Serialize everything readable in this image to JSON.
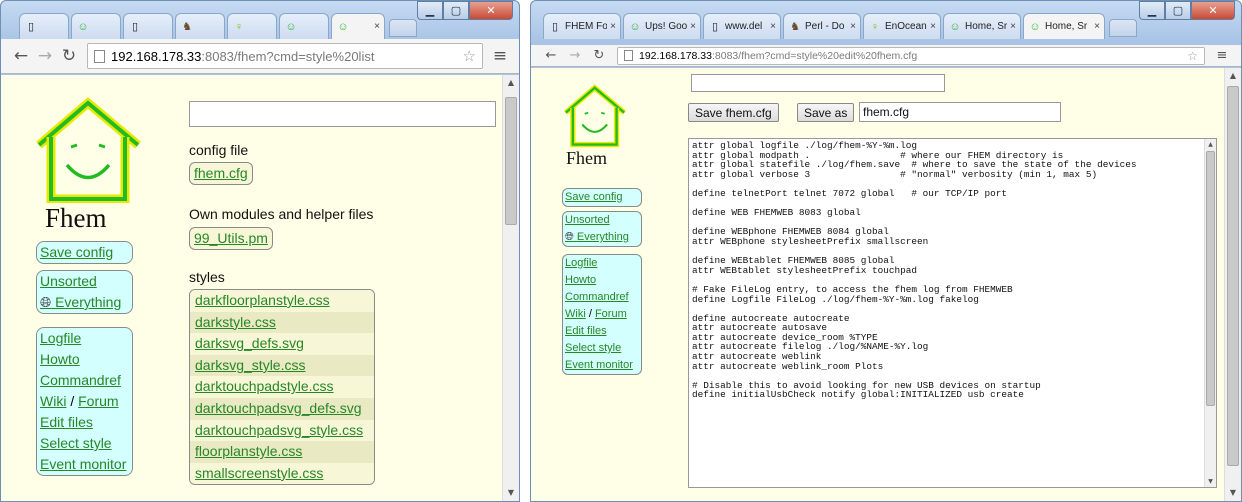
{
  "left_window": {
    "tabs": [
      {
        "icon": "page-icon",
        "label": ""
      },
      {
        "icon": "fhem-smiley-icon",
        "label": ""
      },
      {
        "icon": "page-icon",
        "label": ""
      },
      {
        "icon": "perl-camel-icon",
        "label": ""
      },
      {
        "icon": "enocean-bulb-icon",
        "label": ""
      },
      {
        "icon": "fhem-smiley-icon",
        "label": ""
      },
      {
        "icon": "fhem-smiley-icon",
        "label": "",
        "close": "×",
        "active": true
      }
    ],
    "address": {
      "host": "192.168.178.33",
      "rest": ":8083/fhem?cmd=style%20list"
    },
    "page": {
      "title": "Fhem",
      "menu_group1": [
        "Save config"
      ],
      "menu_group2": [
        "Unsorted",
        "Everything"
      ],
      "menu_group3": [
        {
          "label": "Logfile"
        },
        {
          "label": "Howto"
        },
        {
          "label": "Commandref"
        },
        {
          "label": "Wiki",
          "sep": " / ",
          "label2": "Forum"
        },
        {
          "label": "Edit files"
        },
        {
          "label": "Select style"
        },
        {
          "label": "Event monitor"
        }
      ],
      "config_title": "config file",
      "config_file": "fhem.cfg",
      "modules_title": "Own modules and helper files",
      "modules_file": "99_Utils.pm",
      "styles_title": "styles",
      "styles": [
        "darkfloorplanstyle.css",
        "darkstyle.css",
        "darksvg_defs.svg",
        "darksvg_style.css",
        "darktouchpadstyle.css",
        "darktouchpadsvg_defs.svg",
        "darktouchpadsvg_style.css",
        "floorplanstyle.css",
        "smallscreenstyle.css"
      ]
    }
  },
  "right_window": {
    "tabs": [
      {
        "icon": "page-icon",
        "label": "FHEM Fo",
        "close": "×"
      },
      {
        "icon": "fhem-smiley-icon",
        "label": "Ups! Goo",
        "close": "×"
      },
      {
        "icon": "page-icon",
        "label": "www.del",
        "close": "×"
      },
      {
        "icon": "perl-camel-icon",
        "label": "Perl - Do",
        "close": "×"
      },
      {
        "icon": "enocean-bulb-icon",
        "label": "EnOcean",
        "close": "×"
      },
      {
        "icon": "fhem-smiley-icon",
        "label": "Home, Sr",
        "close": "×"
      },
      {
        "icon": "fhem-smiley-icon",
        "label": "Home, Sr",
        "close": "×",
        "active": true
      }
    ],
    "address": {
      "host": "192.168.178.33",
      "rest": ":8083/fhem?cmd=style%20edit%20fhem.cfg"
    },
    "page": {
      "title": "Fhem",
      "menu_group1": [
        "Save config"
      ],
      "menu_group2": [
        "Unsorted",
        "Everything"
      ],
      "menu_group3": [
        {
          "label": "Logfile"
        },
        {
          "label": "Howto"
        },
        {
          "label": "Commandref"
        },
        {
          "label": "Wiki",
          "sep": " / ",
          "label2": "Forum"
        },
        {
          "label": "Edit files"
        },
        {
          "label": "Select style"
        },
        {
          "label": "Event monitor"
        }
      ],
      "save_button": "Save fhem.cfg",
      "saveas_button": "Save as",
      "saveas_value": "fhem.cfg",
      "editor_lines": [
        "attr global logfile ./log/fhem-%Y-%m.log",
        "attr global modpath .                # where our FHEM directory is",
        "attr global statefile ./log/fhem.save  # where to save the state of the devices",
        "attr global verbose 3                # \"normal\" verbosity (min 1, max 5)",
        "",
        "define telnetPort telnet 7072 global   # our TCP/IP port",
        "",
        "define WEB FHEMWEB 8083 global",
        "",
        "define WEBphone FHEMWEB 8084 global",
        "attr WEBphone stylesheetPrefix smallscreen",
        "",
        "define WEBtablet FHEMWEB 8085 global",
        "attr WEBtablet stylesheetPrefix touchpad",
        "",
        "# Fake FileLog entry, to access the fhem log from FHEMWEB",
        "define Logfile FileLog ./log/fhem-%Y-%m.log fakelog",
        "",
        "define autocreate autocreate",
        "attr autocreate autosave",
        "attr autocreate device_room %TYPE",
        "attr autocreate filelog ./log/%NAME-%Y.log",
        "attr autocreate weblink",
        "attr autocreate weblink_room Plots",
        "",
        "# Disable this to avoid looking for new USB devices on startup",
        "define initialUsbCheck notify global:INITIALIZED usb create"
      ]
    }
  }
}
